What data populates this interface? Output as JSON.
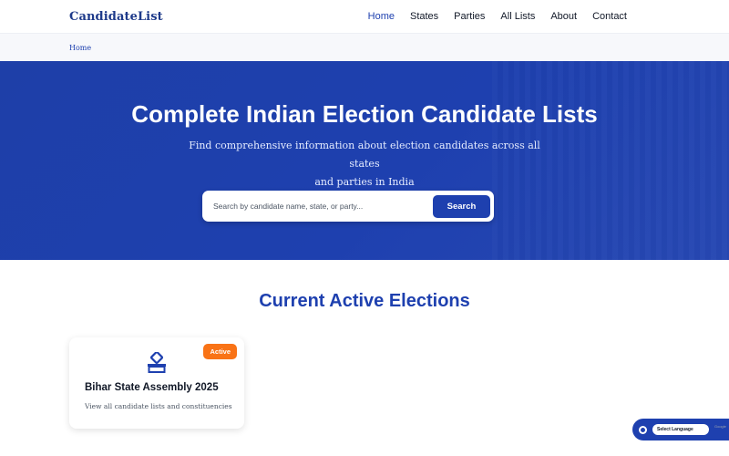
{
  "header": {
    "brand": "CandidateList",
    "nav": [
      {
        "label": "Home",
        "active": true
      },
      {
        "label": "States",
        "active": false
      },
      {
        "label": "Parties",
        "active": false
      },
      {
        "label": "All Lists",
        "active": false
      },
      {
        "label": "About",
        "active": false
      },
      {
        "label": "Contact",
        "active": false
      }
    ]
  },
  "breadcrumb": {
    "home": "Home"
  },
  "hero": {
    "title": "Complete Indian Election Candidate Lists",
    "subtitle_line1": "Find comprehensive information about election candidates across all states",
    "subtitle_line2": "and parties in India",
    "search": {
      "placeholder": "Search by candidate name, state, or party...",
      "value": "",
      "button_label": "Search"
    }
  },
  "elections": {
    "title": "Current Active Elections",
    "cards": [
      {
        "icon": "ballot-box-icon",
        "badge": "Active",
        "title": "Bihar State Assembly 2025",
        "description": "View all candidate lists and constituencies"
      }
    ]
  },
  "language_widget": {
    "icon": "globe-icon",
    "label": "Select Language",
    "brand": "Google"
  },
  "colors": {
    "primary": "#1e40af",
    "badge": "#f97316",
    "breadcrumb_bg": "#f7f8fb"
  }
}
